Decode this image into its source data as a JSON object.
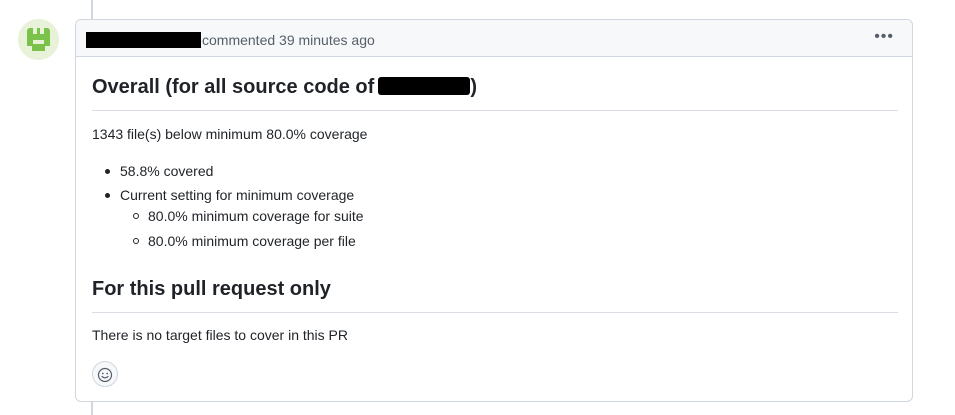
{
  "comment": {
    "meta": "commented 39 minutes ago",
    "menu_icon": "kebab-horizontal-icon",
    "avatar_icon": "bot-avatar-icon",
    "heading_overall": "Overall (for all source code of",
    "heading_overall_close": ")",
    "summary": "1343 file(s) below minimum 80.0% coverage",
    "list": {
      "covered": "58.8% covered",
      "current_setting": "Current setting for minimum coverage",
      "suite_min": "80.0% minimum coverage for suite",
      "file_min": "80.0% minimum coverage per file"
    },
    "heading_pr": "For this pull request only",
    "pr_note": "There is no target files to cover in this PR",
    "reaction_icon": "smiley-icon"
  },
  "colors": {
    "avatar_green": "#7bc24a",
    "border": "#d0d7de",
    "header_bg": "#f6f8fa",
    "muted_text": "#57606a"
  }
}
